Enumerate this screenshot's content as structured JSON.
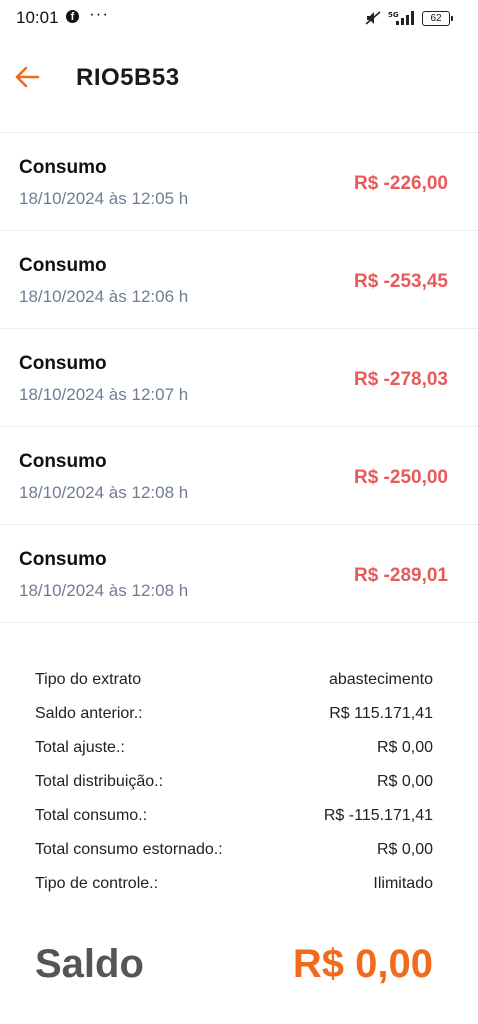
{
  "status_bar": {
    "time": "10:01",
    "more": "···",
    "network": "5G",
    "battery": "62",
    "icons": [
      "facebook-icon",
      "mute-icon",
      "signal-icon",
      "battery-icon"
    ]
  },
  "header": {
    "title": "RIO5B53",
    "back_icon": "arrow-left-icon",
    "accent_color": "#f26a1b"
  },
  "transactions": [
    {
      "type": "Consumo",
      "date": "18/10/2024 às 12:05 h",
      "amount": "R$ -226,00"
    },
    {
      "type": "Consumo",
      "date": "18/10/2024 às 12:06 h",
      "amount": "R$ -253,45"
    },
    {
      "type": "Consumo",
      "date": "18/10/2024 às 12:07 h",
      "amount": "R$ -278,03"
    },
    {
      "type": "Consumo",
      "date": "18/10/2024 às 12:08 h",
      "amount": "R$ -250,00"
    },
    {
      "type": "Consumo",
      "date": "18/10/2024 às 12:08 h",
      "amount": "R$ -289,01"
    }
  ],
  "summary": [
    {
      "label": "Tipo do extrato",
      "value": "abastecimento"
    },
    {
      "label": "Saldo anterior.:",
      "value": "R$ 115.171,41"
    },
    {
      "label": "Total ajuste.:",
      "value": "R$ 0,00"
    },
    {
      "label": "Total distribuição.:",
      "value": "R$ 0,00"
    },
    {
      "label": "Total consumo.:",
      "value": "R$ -115.171,41"
    },
    {
      "label": "Total consumo estornado.:",
      "value": "R$ 0,00"
    },
    {
      "label": "Tipo de controle.:",
      "value": "Ilimitado"
    }
  ],
  "balance": {
    "label": "Saldo",
    "value": "R$ 0,00"
  },
  "colors": {
    "negative_amount": "#e85a5a",
    "date_text": "#6f7d93",
    "balance_value": "#f26a1b"
  }
}
